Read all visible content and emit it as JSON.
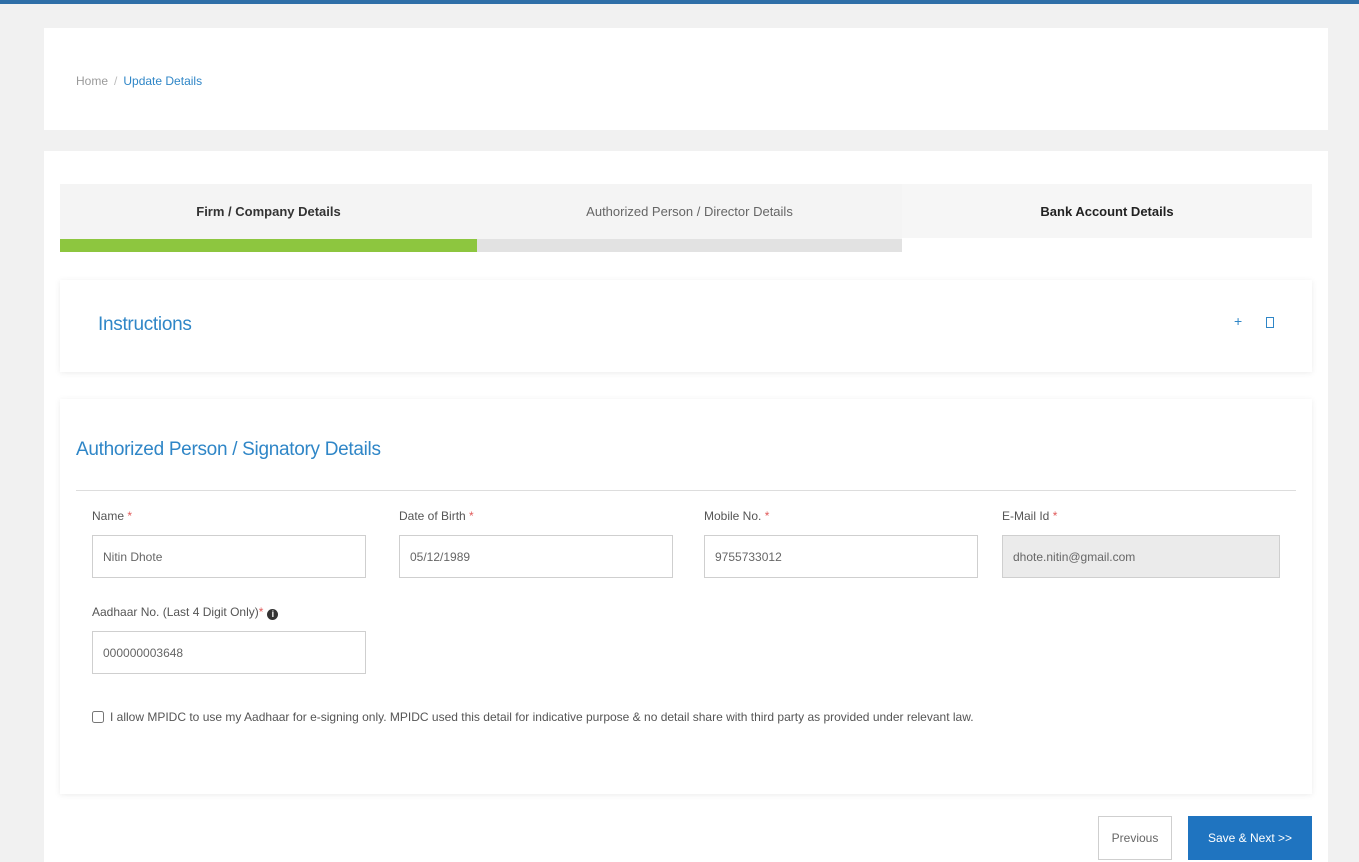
{
  "breadcrumb": {
    "home": "Home",
    "separator": "/",
    "current": "Update Details"
  },
  "steps": [
    {
      "label": "Firm / Company Details",
      "state": "completed"
    },
    {
      "label": "Authorized Person / Director Details",
      "state": "active"
    },
    {
      "label": "Bank Account Details",
      "state": "pending"
    }
  ],
  "instructions": {
    "title": "Instructions",
    "expand_symbol": "+"
  },
  "form": {
    "section_title": "Authorized Person / Signatory Details",
    "required_marker": "*",
    "name": {
      "label": "Name",
      "value": "Nitin Dhote"
    },
    "dob": {
      "label": "Date of Birth",
      "value": "05/12/1989"
    },
    "mobile": {
      "label": "Mobile No.",
      "value": "9755733012"
    },
    "email": {
      "label": "E-Mail Id",
      "value": "dhote.nitin@gmail.com"
    },
    "aadhaar": {
      "label": "Aadhaar No. (Last 4 Digit Only)",
      "value": "000000003648",
      "info_icon": "i"
    },
    "consent": "I allow MPIDC to use my Aadhaar for e-signing only. MPIDC used this detail for indicative purpose & no detail share with third party as provided under relevant law."
  },
  "buttons": {
    "previous": "Previous",
    "save_next": "Save & Next >>"
  },
  "colors": {
    "accent": "#2f86c7",
    "progress_done": "#8dc63f",
    "primary_button": "#1f74c0",
    "required": "#e05a5a"
  }
}
